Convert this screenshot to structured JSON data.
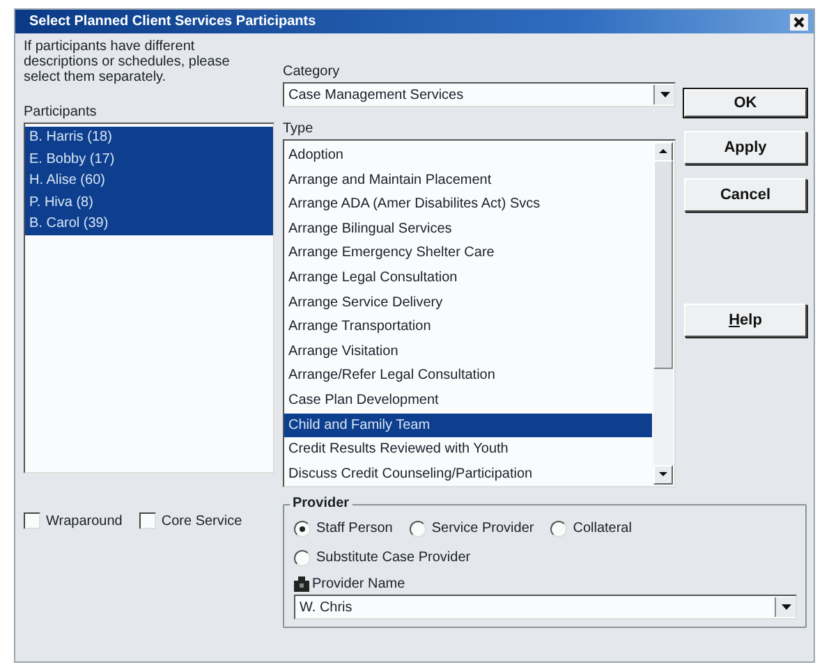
{
  "window": {
    "title": "Select Planned Client Services Participants"
  },
  "instructions": "If participants have different descriptions or schedules, please select them separately.",
  "participants": {
    "label": "Participants",
    "items": [
      {
        "text": "B. Harris (18)",
        "selected": true
      },
      {
        "text": "E. Bobby (17)",
        "selected": true
      },
      {
        "text": "H. Alise (60)",
        "selected": true
      },
      {
        "text": "P. Hiva (8)",
        "selected": true
      },
      {
        "text": "B. Carol (39)",
        "selected": true
      }
    ]
  },
  "category": {
    "label": "Category",
    "value": "Case Management Services"
  },
  "type": {
    "label": "Type",
    "items": [
      {
        "text": "Adoption",
        "selected": false
      },
      {
        "text": "Arrange and Maintain Placement",
        "selected": false
      },
      {
        "text": "Arrange ADA (Amer Disabilites Act) Svcs",
        "selected": false
      },
      {
        "text": "Arrange Bilingual Services",
        "selected": false
      },
      {
        "text": "Arrange Emergency Shelter Care",
        "selected": false
      },
      {
        "text": "Arrange Legal Consultation",
        "selected": false
      },
      {
        "text": "Arrange Service Delivery",
        "selected": false
      },
      {
        "text": "Arrange Transportation",
        "selected": false
      },
      {
        "text": "Arrange Visitation",
        "selected": false
      },
      {
        "text": "Arrange/Refer Legal Consultation",
        "selected": false
      },
      {
        "text": "Case Plan Development",
        "selected": false
      },
      {
        "text": "Child and Family Team",
        "selected": true
      },
      {
        "text": "Credit Results Reviewed with Youth",
        "selected": false
      },
      {
        "text": "Discuss Credit Counseling/Participation",
        "selected": false
      }
    ]
  },
  "checkboxes": [
    {
      "label": "Wraparound",
      "checked": false
    },
    {
      "label": "Core Service",
      "checked": false
    }
  ],
  "buttons": [
    {
      "label": "OK",
      "default": true
    },
    {
      "label": "Apply",
      "default": false
    },
    {
      "label": "Cancel",
      "default": false
    },
    {
      "label": "Help",
      "default": false
    }
  ],
  "provider": {
    "title": "Provider",
    "radio_rows": [
      [
        {
          "label": "Staff Person",
          "selected": true
        },
        {
          "label": "Service Provider",
          "selected": false
        },
        {
          "label": "Collateral",
          "selected": false
        }
      ],
      [
        {
          "label": "Substitute Case Provider",
          "selected": false
        }
      ]
    ],
    "name_label": "Provider Name",
    "name_value": "W. Chris"
  }
}
